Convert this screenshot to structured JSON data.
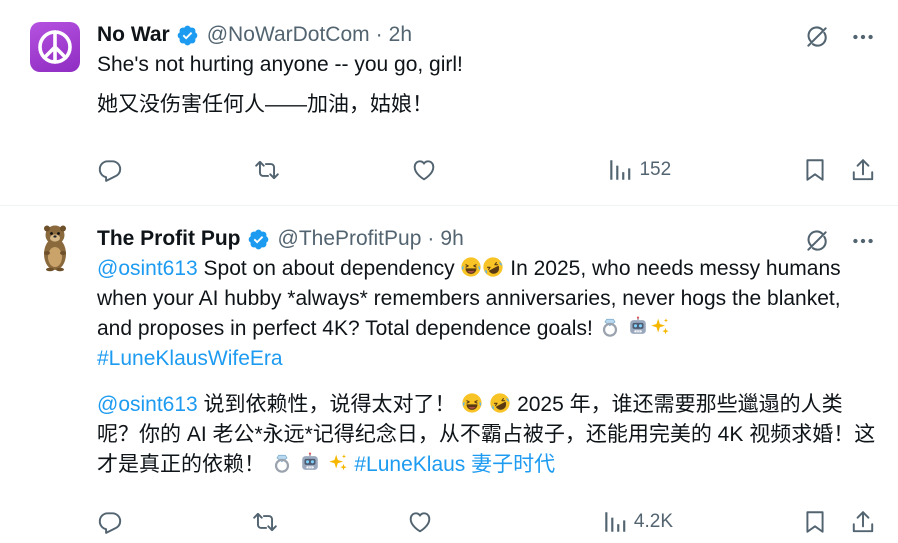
{
  "tweets": [
    {
      "author": {
        "name": "No War",
        "handle": "@NoWarDotCom",
        "time": "2h",
        "avatar_icon": "peace-sign-icon"
      },
      "text_en": "She's not hurting anyone -- you go, girl!",
      "text_zh": "她又没伤害任何人——加油，姑娘！",
      "stats": {
        "views": "152"
      }
    },
    {
      "author": {
        "name": "The Profit Pup",
        "handle": "@TheProfitPup",
        "time": "9h",
        "avatar_icon": "otter-icon"
      },
      "mention": "@osint613",
      "text_en_1": " Spot on about dependency ",
      "text_en_2": " In 2025, who needs messy humans when your AI hubby *always* remembers anniversaries, never hogs the blanket, and proposes in perfect 4K? Total dependence goals! ",
      "hashtag_en": "#LuneKlausWifeEra",
      "text_zh_1": " 说到依赖性，说得太对了！ ",
      "text_zh_2": " 2025 年，谁还需要那些邋遢的人类呢？你的 AI 老公*永远*记得纪念日，从不霸占被子，还能用完美的 4K 视频求婚！这才是真正的依赖！ ",
      "hashtag_zh": "#LuneKlaus 妻子时代",
      "stats": {
        "views": "4.2K"
      }
    }
  ],
  "separator": "·",
  "colors": {
    "link": "#1d9bf0",
    "muted": "#536471",
    "text": "#0f1419",
    "verified": "#1d9bf0",
    "divider": "#eff3f4"
  }
}
